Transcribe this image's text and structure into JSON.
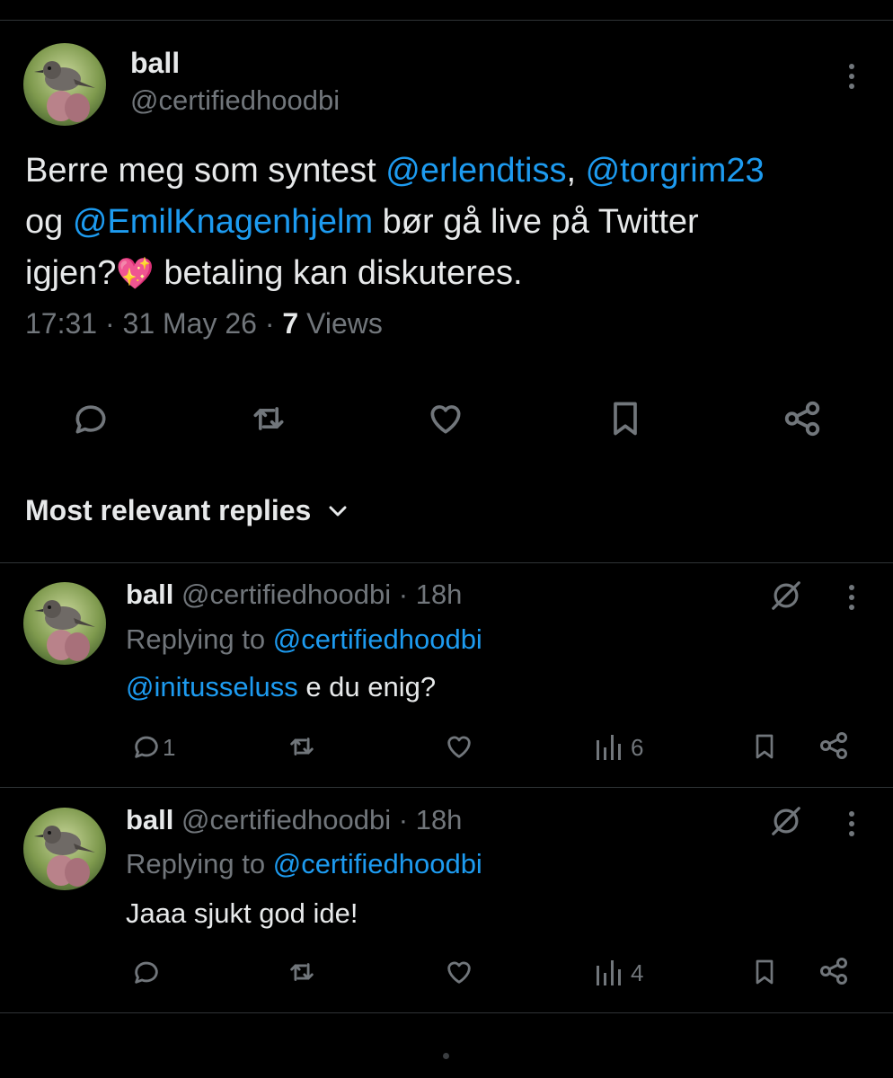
{
  "tweet": {
    "display_name": "ball",
    "handle": "@certifiedhoodbi",
    "text": {
      "p1": "Berre meg som syntest ",
      "m1": "@erlendtiss",
      "p2": ", ",
      "m2": "@torgrim23",
      "p3": "og ",
      "m3": "@EmilKnagenhjelm",
      "p4": " bør gå live på Twitter",
      "p5": "igjen?",
      "emoji": "💖",
      "p6": " betaling kan diskuteres."
    },
    "time": "17:31",
    "sep": "·",
    "date": "31 May 26",
    "views_count": "7",
    "views_label": "Views"
  },
  "replies_header": {
    "label": "Most relevant replies"
  },
  "replies": [
    {
      "display_name": "ball",
      "handle": "@certifiedhoodbi",
      "time": "· 18h",
      "replying_prefix": "Replying to ",
      "replying_to": "@certifiedhoodbi",
      "mention": "@initusseluss",
      "text": " e du enig?",
      "reply_count": "1",
      "views": "6"
    },
    {
      "display_name": "ball",
      "handle": "@certifiedhoodbi",
      "time": "· 18h",
      "replying_prefix": "Replying to ",
      "replying_to": "@certifiedhoodbi",
      "text": "Jaaa sjukt god ide!",
      "reply_count": "",
      "views": "4"
    }
  ],
  "colors": {
    "background": "#000000",
    "text": "#e7e9ea",
    "muted": "#71767b",
    "link": "#1d9bf0",
    "divider": "#2f3336"
  }
}
